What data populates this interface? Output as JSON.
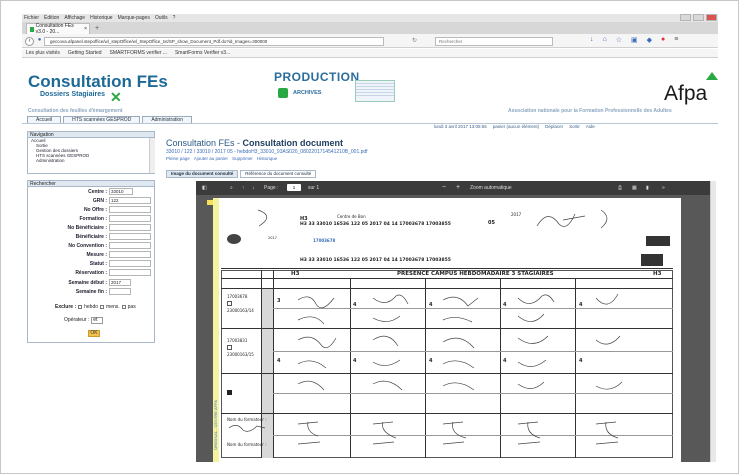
{
  "browser": {
    "menu": [
      "Fichier",
      "Édition",
      "Affichage",
      "Historique",
      "Marque-pages",
      "Outils",
      "?"
    ],
    "tab_title": "Consultation FEs v3.0 - 20...",
    "new_tab": "+",
    "url": "geccova.afpanel.stepoffice/wl_stepOffice/wl_StepOffice_txt/SP_show_Document_Pdf.do?id_Images=300000",
    "search_placeholder": "Rechercher",
    "bookmarks": [
      "Les plus visités",
      "Getting Started",
      "SMARTFORMS verifier ...",
      "SmartForms Verifier v3..."
    ]
  },
  "header": {
    "title": "Consultation FEs",
    "subtitle": "Dossiers Stagiaires",
    "consult_sub": "Consultation des feuilles d'émargement",
    "environment": "PRODUCTION",
    "archives": "ARCHIVES",
    "brand": "Afpa",
    "association": "Association nationale pour la Formation Professionnelle des Adultes",
    "menu": [
      "Accueil",
      "HTS scannées GESPROD",
      "Administration"
    ],
    "date": "lundi 3 avril 2017  13:05:55",
    "links": [
      "panier (aucun élément)",
      "Déplacer",
      "Sortir",
      "Aide"
    ]
  },
  "navigation": {
    "title": "Navigation",
    "items": [
      "Accueil",
      "Sortie",
      "Gestion des dossiers",
      "HTS scannées GESPROD",
      "Administration"
    ]
  },
  "search": {
    "title": "Rechercher",
    "fields": [
      {
        "label": "Centre :",
        "value": "33010"
      },
      {
        "label": "GRN :",
        "value": "122"
      },
      {
        "label": "No Offre :",
        "value": ""
      },
      {
        "label": "Formation :",
        "value": ""
      },
      {
        "label": "No Bénéficiaire :",
        "value": ""
      },
      {
        "label": "Bénéficiaire :",
        "value": ""
      },
      {
        "label": "No Convention :",
        "value": ""
      },
      {
        "label": "Mesure :",
        "value": ""
      },
      {
        "label": "Statut :",
        "value": ""
      },
      {
        "label": "Réservation :",
        "value": ""
      },
      {
        "label": "Semaine début :",
        "value": "2017"
      },
      {
        "label": "Semaine fin :",
        "value": ""
      }
    ],
    "exclude_label": "Exclure :",
    "exclude_options": [
      "hebdo",
      "mens.",
      "pas"
    ],
    "operator_label": "Opérateur :",
    "operator_value": "et",
    "ok": "OK"
  },
  "content": {
    "title_prefix": "Consultation FEs - ",
    "title_bold": "Consultation document",
    "path": "33010 / 122 / 33010 / 2017 05 - hebdoH3_33010_93AS020_0802201714541210B_001.pdf",
    "links": [
      "Pleine page",
      "Ajouter au panier",
      "Supprimer",
      "Historique"
    ],
    "tabs": [
      "Image du document consulté",
      "Référence du document consulté"
    ]
  },
  "pdf": {
    "page_label": "Page :",
    "page_value": "1",
    "page_total": "sur 1",
    "zoom": "Zoom automatique",
    "header_code": "H3  33  33010  16536  122  05 2017  04  14  17003678  17003855",
    "centre": "Centre de Bon",
    "table_title": "PRESENCE CAMPUS HEBDOMADAIRE 3 STAGIAIRES",
    "col_h3": "H3",
    "year": "2017",
    "doc_num": "05",
    "nom": "Nom du formateur :",
    "row_ids": [
      "17003678",
      "23000163/14",
      "17003831",
      "23000163/15"
    ],
    "vertical": "ORIGINAL - CENTRE AFPA"
  }
}
